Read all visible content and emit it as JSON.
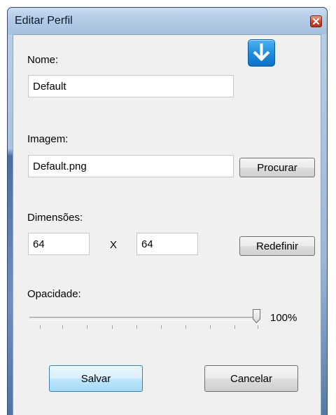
{
  "window": {
    "title": "Editar Perfil"
  },
  "name": {
    "label": "Nome:",
    "value": "Default"
  },
  "image": {
    "label": "Imagem:",
    "value": "Default.png",
    "browse_label": "Procurar"
  },
  "dimensions": {
    "label": "Dimensões:",
    "width": "64",
    "separator": "X",
    "height": "64",
    "reset_label": "Redefinir"
  },
  "opacity": {
    "label": "Opacidade:",
    "value_text": "100%",
    "value": 1.0
  },
  "actions": {
    "save_label": "Salvar",
    "cancel_label": "Cancelar"
  },
  "colors": {
    "accent": "#1f8fdf",
    "titlebar": "#b3cbe6",
    "client": "#f0f0f0"
  },
  "icons": {
    "download": "download-arrow-icon",
    "close": "close-icon"
  }
}
